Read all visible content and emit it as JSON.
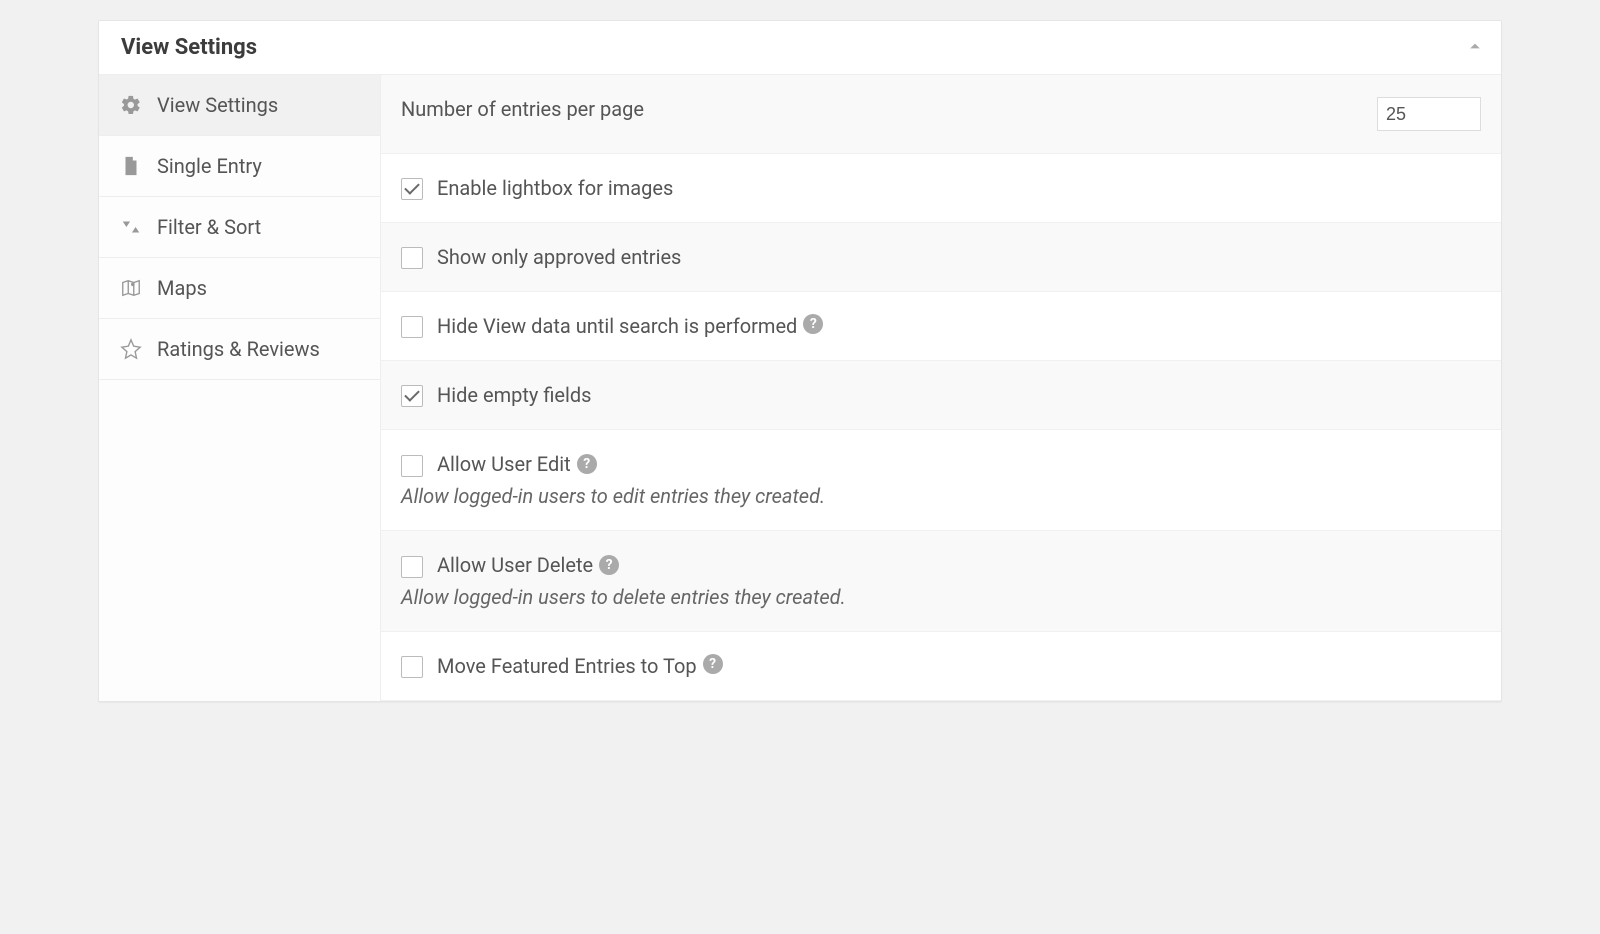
{
  "panel": {
    "title": "View Settings"
  },
  "sidebar": {
    "items": [
      {
        "label": "View Settings"
      },
      {
        "label": "Single Entry"
      },
      {
        "label": "Filter & Sort"
      },
      {
        "label": "Maps"
      },
      {
        "label": "Ratings & Reviews"
      }
    ]
  },
  "settings": {
    "entries_per_page": {
      "label": "Number of entries per page",
      "value": "25"
    },
    "lightbox": {
      "label": "Enable lightbox for images",
      "checked": true
    },
    "approved_only": {
      "label": "Show only approved entries",
      "checked": false
    },
    "hide_until_search": {
      "label": "Hide View data until search is performed",
      "checked": false,
      "help": true
    },
    "hide_empty": {
      "label": "Hide empty fields",
      "checked": true
    },
    "user_edit": {
      "label": "Allow User Edit",
      "checked": false,
      "help": true,
      "desc": "Allow logged-in users to edit entries they created."
    },
    "user_delete": {
      "label": "Allow User Delete",
      "checked": false,
      "help": true,
      "desc": "Allow logged-in users to delete entries they created."
    },
    "featured_top": {
      "label": "Move Featured Entries to Top",
      "checked": false,
      "help": true
    }
  }
}
